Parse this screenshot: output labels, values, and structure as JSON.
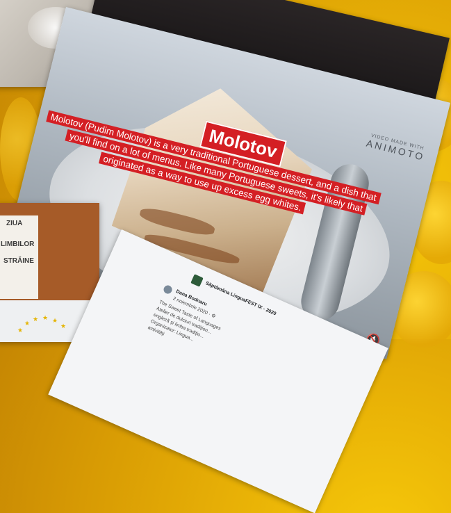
{
  "video": {
    "title": "Molotov",
    "description_lines": [
      "Molotov (Pudim Molotov) is a very traditional Portuguese dessert, and a dish that",
      "you'll find on a lot of menus. Like many Portuguese sweets, it's likely that",
      "originated as a way to use up excess egg whites."
    ],
    "badge_small": "VIDEO MADE WITH",
    "badge_big": "ANIMOTO",
    "mute_icon": "speaker-muted-icon"
  },
  "poster": {
    "lines": [
      "ZIUA",
      "LIMBILOR",
      "STRĂINE"
    ]
  },
  "post": {
    "group": "Săptămâna LinguaFEST IX - 2020",
    "author": "Dana Bodnaru",
    "date": "2 noiembrie 2020 · ⚙",
    "lines": [
      "The Sweet Taste of Languages",
      "Atelier de dulciuri tradițion...",
      "engleză și limba tradițio...",
      "Organizator: Lingua...",
      "activități"
    ]
  },
  "colors": {
    "caption_red": "#d41f24",
    "background_yellow": "#e8b106"
  }
}
